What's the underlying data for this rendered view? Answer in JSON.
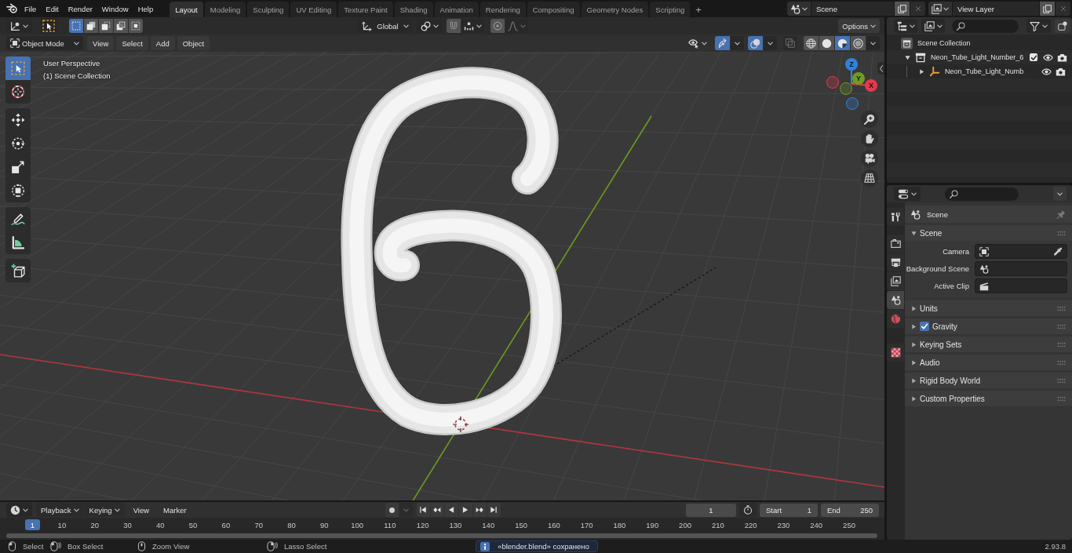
{
  "top_bar": {
    "menus": [
      "File",
      "Edit",
      "Render",
      "Window",
      "Help"
    ],
    "workspaces": [
      {
        "label": "Layout",
        "selected": true
      },
      {
        "label": "Modeling",
        "selected": false
      },
      {
        "label": "Sculpting",
        "selected": false
      },
      {
        "label": "UV Editing",
        "selected": false
      },
      {
        "label": "Texture Paint",
        "selected": false
      },
      {
        "label": "Shading",
        "selected": false
      },
      {
        "label": "Animation",
        "selected": false
      },
      {
        "label": "Rendering",
        "selected": false
      },
      {
        "label": "Compositing",
        "selected": false
      },
      {
        "label": "Geometry Nodes",
        "selected": false
      },
      {
        "label": "Scripting",
        "selected": false
      }
    ],
    "add_workspace": "+",
    "scene": "Scene",
    "view_layer": "View Layer"
  },
  "viewport": {
    "tool_header": {
      "select_modes": [
        {
          "kind": "set",
          "selected": true
        },
        {
          "kind": "extend",
          "selected": false
        },
        {
          "kind": "subtract",
          "selected": false
        },
        {
          "kind": "invert",
          "selected": false
        },
        {
          "kind": "intersect",
          "selected": false
        }
      ],
      "orientation": "Global",
      "snap": false,
      "proportional": false,
      "options": "Options"
    },
    "header": {
      "mode": "Object Mode",
      "menus": [
        "View",
        "Select",
        "Add",
        "Object"
      ],
      "gizmos": true,
      "overlays": true,
      "xray": false,
      "shading": [
        {
          "kind": "wireframe",
          "selected": false
        },
        {
          "kind": "solid",
          "selected": false
        },
        {
          "kind": "material",
          "selected": true
        },
        {
          "kind": "rendered",
          "selected": false
        }
      ]
    },
    "info": [
      "User Perspective",
      "(1) Scene Collection"
    ],
    "tools": [
      {
        "kind": "select",
        "selected": true
      },
      {
        "kind": "cursor",
        "selected": false
      },
      {
        "kind": "move",
        "selected": false
      },
      {
        "kind": "rotate",
        "selected": false
      },
      {
        "kind": "scale",
        "selected": false
      },
      {
        "kind": "transform",
        "selected": false
      },
      {
        "kind": "annotate",
        "selected": false
      },
      {
        "kind": "measure",
        "selected": false
      },
      {
        "kind": "add_cube",
        "selected": false
      }
    ],
    "gizmo_axes": [
      {
        "label": "X",
        "color": "#e5394c"
      },
      {
        "label": "Y",
        "color": "#6f9c22"
      },
      {
        "label": "Z",
        "color": "#2d83e0"
      }
    ]
  },
  "outliner": {
    "tree": [
      {
        "label": "Scene Collection",
        "kind": "scene_collection",
        "children": [
          {
            "label": "Neon_Tube_Light_Number_6",
            "kind": "collection",
            "expanded": true,
            "checked": true,
            "visible": true,
            "renderable": true,
            "children": [
              {
                "label": "Neon_Tube_Light_Numb",
                "kind": "object",
                "expanded": false,
                "visible": true,
                "renderable": true
              }
            ]
          }
        ]
      }
    ]
  },
  "properties": {
    "tabs": [
      {
        "kind": "tool",
        "selected": false
      },
      {
        "kind": "render",
        "selected": false
      },
      {
        "kind": "output",
        "selected": false
      },
      {
        "kind": "view_layer",
        "selected": false
      },
      {
        "kind": "scene",
        "selected": true
      },
      {
        "kind": "world",
        "selected": false
      },
      {
        "kind": "texture",
        "selected": false
      }
    ],
    "context": "Scene",
    "panels": [
      {
        "label": "Scene",
        "kind": "plain",
        "expanded": true,
        "fields": [
          {
            "label": "Camera",
            "kind": "camera"
          },
          {
            "label": "Background Scene",
            "kind": "scene"
          },
          {
            "label": "Active Clip",
            "kind": "clip"
          }
        ]
      },
      {
        "label": "Units",
        "kind": "plain",
        "expanded": false
      },
      {
        "label": "Gravity",
        "kind": "toggle",
        "expanded": false,
        "checked": true
      },
      {
        "label": "Keying Sets",
        "kind": "plain",
        "expanded": false
      },
      {
        "label": "Audio",
        "kind": "plain",
        "expanded": false
      },
      {
        "label": "Rigid Body World",
        "kind": "plain",
        "expanded": false
      },
      {
        "label": "Custom Properties",
        "kind": "plain",
        "expanded": false
      }
    ]
  },
  "timeline": {
    "dropdowns": [
      "Playback",
      "Keying"
    ],
    "menus": [
      "View",
      "Marker"
    ],
    "auto_keying": false,
    "current_frame": "1",
    "start_label": "Start",
    "start": "1",
    "end_label": "End",
    "end": "250",
    "playhead": "1",
    "ticks": [
      "10",
      "20",
      "30",
      "40",
      "50",
      "60",
      "70",
      "80",
      "90",
      "100",
      "110",
      "120",
      "130",
      "140",
      "150",
      "160",
      "170",
      "180",
      "190",
      "200",
      "210",
      "220",
      "230",
      "240",
      "250"
    ]
  },
  "status_bar": {
    "hints": [
      {
        "kind": "left",
        "label": "Select"
      },
      {
        "kind": "drag",
        "label": "Box Select"
      },
      {
        "kind": "middle",
        "label": "Zoom View"
      },
      {
        "kind": "right",
        "label": "Lasso Select"
      }
    ],
    "message": "«blender.blend» сохранено",
    "version": "2.93.8"
  }
}
